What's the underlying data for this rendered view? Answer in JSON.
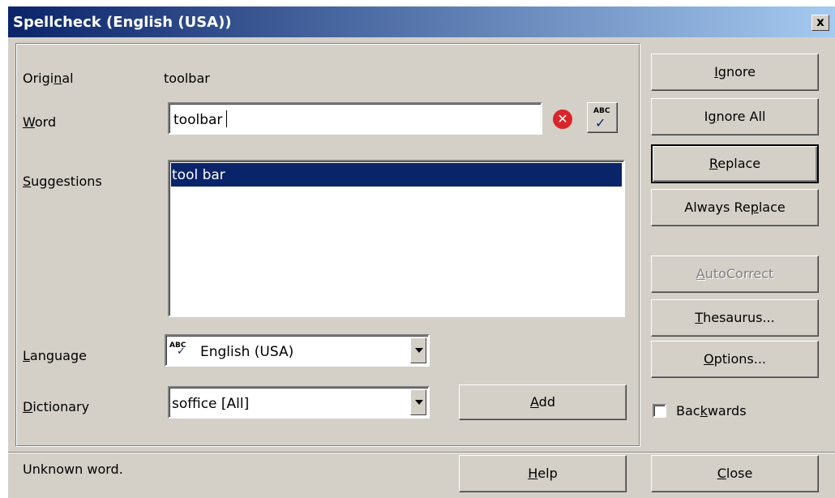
{
  "dialog": {
    "title": "Spellcheck (English (USA))",
    "close_symbol": "x"
  },
  "labels": {
    "original_pre": "Origi",
    "original_ul": "n",
    "original_post": "al",
    "word_ul": "W",
    "word_post": "ord",
    "suggestions_ul": "S",
    "suggestions_post": "uggestions",
    "language_ul": "L",
    "language_post": "anguage",
    "dictionary_ul": "D",
    "dictionary_post": "ictionary"
  },
  "original_word": "toolbar",
  "word_input": {
    "value": "toolbar"
  },
  "suggestions": [
    "tool bar"
  ],
  "language": {
    "icon_text": "ABC",
    "value": "English (USA)"
  },
  "dictionary": {
    "value": "soffice [All]"
  },
  "buttons": {
    "ignore_ul": "I",
    "ignore_post": "gnore",
    "ignore_all_pre": "I",
    "ignore_all_ul": "g",
    "ignore_all_post": "nore All",
    "replace_ul": "R",
    "replace_post": "eplace",
    "always_replace_pre": "Always Re",
    "always_replace_ul": "p",
    "always_replace_post": "lace",
    "autocorrect_ul": "A",
    "autocorrect_post": "utoCorrect",
    "thesaurus_ul": "T",
    "thesaurus_post": "hesaurus...",
    "options_ul": "O",
    "options_post": "ptions...",
    "add_ul": "A",
    "add_post": "dd",
    "help_ul": "H",
    "help_post": "elp",
    "close_ul": "C",
    "close_post": "lose"
  },
  "backwards": {
    "pre": "Bac",
    "ul": "k",
    "post": "wards",
    "checked": false
  },
  "status": "Unknown word.",
  "colors": {
    "title_start": "#0a246a",
    "title_end": "#a6caf0",
    "selection": "#0a246a",
    "dialog_bg": "#d4d0c8",
    "error_icon": "#d9252a"
  }
}
